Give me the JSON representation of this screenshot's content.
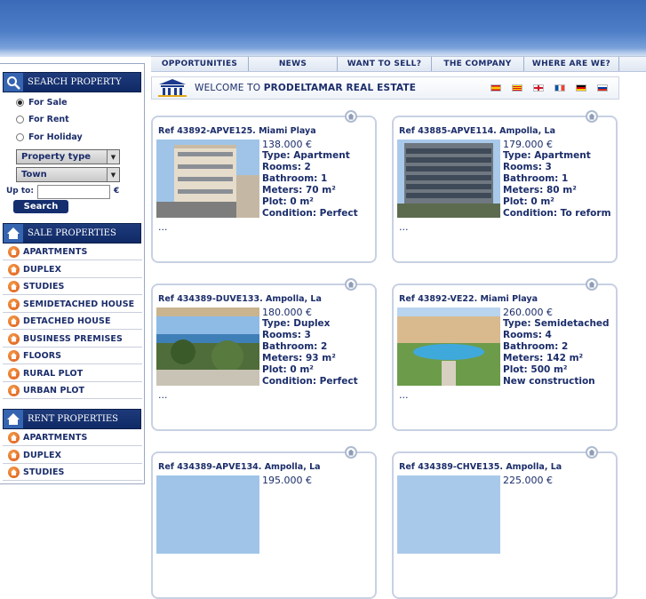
{
  "nav": [
    "OPPORTUNITIES",
    "NEWS",
    "WANT TO SELL?",
    "THE COMPANY",
    "WHERE ARE WE?"
  ],
  "welcome": {
    "prefix": "WELCOME TO ",
    "company": "PRODELTAMAR REAL ESTATE"
  },
  "flags": [
    "spanish-flag",
    "catalan-flag",
    "english-flag",
    "french-flag",
    "german-flag",
    "russian-flag"
  ],
  "search": {
    "title": "SEARCH PROPERTY",
    "options": [
      "For Sale",
      "For Rent",
      "For Holiday"
    ],
    "selected": "For Sale",
    "property_type": "Property type",
    "town": "Town",
    "upto_label": "Up to:",
    "upto_value": "",
    "currency": "€",
    "button": "Search"
  },
  "sale": {
    "title": "SALE PROPERTIES",
    "items": [
      "APARTMENTS",
      "DUPLEX",
      "STUDIES",
      "SEMIDETACHED HOUSE",
      "DETACHED HOUSE",
      "BUSINESS PREMISES",
      "FLOORS",
      "RURAL PLOT",
      "URBAN PLOT"
    ]
  },
  "rent": {
    "title": "RENT PROPERTIES",
    "items": [
      "APARTMENTS",
      "DUPLEX",
      "STUDIES"
    ]
  },
  "listings": [
    {
      "ref": "Ref 43892-APVE125. Miami Playa",
      "price": "138.000 €",
      "type": "Type: Apartment",
      "rooms": "Rooms: 2",
      "bath": "Bathroom: 1",
      "meters": "Meters: 70 m²",
      "plot": "Plot: 0 m²",
      "cond": "Condition: Perfect",
      "more": "..."
    },
    {
      "ref": "Ref 43885-APVE114. Ampolla, La",
      "price": "179.000 €",
      "type": "Type: Apartment",
      "rooms": "Rooms: 3",
      "bath": "Bathroom: 1",
      "meters": "Meters: 80 m²",
      "plot": "Plot: 0 m²",
      "cond": "Condition: To reform",
      "more": "..."
    },
    {
      "ref": "Ref 434389-DUVE133. Ampolla, La",
      "price": "180.000 €",
      "type": "Type: Duplex",
      "rooms": "Rooms: 3",
      "bath": "Bathroom: 2",
      "meters": "Meters: 93 m²",
      "plot": "Plot: 0 m²",
      "cond": "Condition: Perfect",
      "more": "..."
    },
    {
      "ref": "Ref 43892-VE22. Miami Playa",
      "price": "260.000 €",
      "type": "Type: Semidetached",
      "rooms": "Rooms: 4",
      "bath": "Bathroom: 2",
      "meters": "Meters: 142 m²",
      "plot": "Plot: 500 m²",
      "cond": "New construction",
      "more": "..."
    },
    {
      "ref": "Ref 434389-APVE134. Ampolla, La",
      "price": "195.000 €",
      "type": "",
      "rooms": "",
      "bath": "",
      "meters": "",
      "plot": "",
      "cond": "",
      "more": ""
    },
    {
      "ref": "Ref 434389-CHVE135. Ampolla, La",
      "price": "225.000 €",
      "type": "",
      "rooms": "",
      "bath": "",
      "meters": "",
      "plot": "",
      "cond": "",
      "more": ""
    }
  ]
}
